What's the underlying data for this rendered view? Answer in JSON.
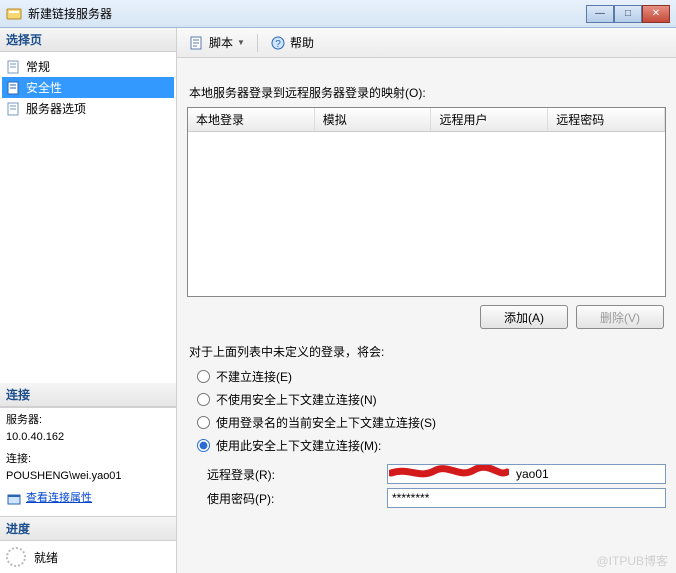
{
  "window": {
    "title": "新建链接服务器"
  },
  "winbuttons": {
    "min": "—",
    "max": "□",
    "close": "✕"
  },
  "left": {
    "select_page": "选择页",
    "nav": {
      "general": "常规",
      "security": "安全性",
      "server_options": "服务器选项"
    },
    "connection": {
      "header": "连接",
      "server_label": "服务器:",
      "server_value": "10.0.40.162",
      "conn_label": "连接:",
      "conn_value": "POUSHENG\\wei.yao01",
      "view_props": "查看连接属性"
    },
    "progress": {
      "header": "进度",
      "status": "就绪"
    }
  },
  "toolbar": {
    "script": "脚本",
    "help": "帮助"
  },
  "content": {
    "mapping_label": "本地服务器登录到远程服务器登录的映射(O):",
    "grid_headers": {
      "local_login": "本地登录",
      "impersonate": "模拟",
      "remote_user": "远程用户",
      "remote_password": "远程密码"
    },
    "add_btn": "添加(A)",
    "remove_btn": "删除(V)",
    "radio_intro": "对于上面列表中未定义的登录，将会:",
    "radios": {
      "r1": "不建立连接(E)",
      "r2": "不使用安全上下文建立连接(N)",
      "r3": "使用登录名的当前安全上下文建立连接(S)",
      "r4": "使用此安全上下文建立连接(M):"
    },
    "fields": {
      "remote_login_label": "远程登录(R):",
      "remote_login_value": "yao01",
      "password_label": "使用密码(P):",
      "password_value": "********"
    }
  },
  "watermark": "@ITPUB博客"
}
